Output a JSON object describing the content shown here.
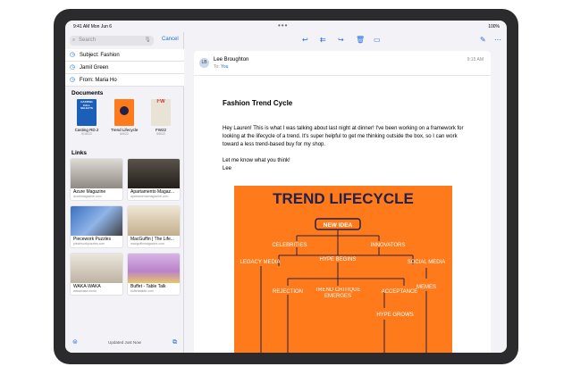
{
  "status": {
    "time": "9:41 AM  Mon Jun 6",
    "dots": "•••",
    "battery": "100%"
  },
  "sidebar": {
    "search_placeholder": "Search",
    "cancel_label": "Cancel",
    "suggestions": [
      "Subject: Fashion",
      "Jamil Green",
      "From: Maria Ho"
    ],
    "documents_heading": "Documents",
    "documents": [
      {
        "name": "Casting RD.2",
        "date": "5/16/22",
        "cover_text": "CASTING CALL SELECTS",
        "color": "#1b5fb8"
      },
      {
        "name": "Trend Lifecycle",
        "date": "6/6/22",
        "cover_text": "",
        "color": "#ff7a1a"
      },
      {
        "name": "FW22",
        "date": "5/8/22",
        "cover_text": "FW",
        "color": "#d33a2f"
      }
    ],
    "links_heading": "Links",
    "links": [
      {
        "title": "Azure Magazine",
        "url": "azuremagazine.com",
        "color": "#b8b4ae"
      },
      {
        "title": "Apartamento Magaz...",
        "url": "apartamentomagazine.com",
        "color": "#3a3631"
      },
      {
        "title": "Piecework Puzzles",
        "url": "pieceworkpuzzles.com",
        "color": "#5a88c9"
      },
      {
        "title": "MacGuffin | The Life...",
        "url": "macguffinmagazine.com",
        "color": "#d7c7a8"
      },
      {
        "title": "WAKA-WAKA",
        "url": "wakawaka.world",
        "color": "#d9d3c8"
      },
      {
        "title": "Buffet - Table Talk",
        "url": "buffetatable.com",
        "color": "#c6a3d8"
      }
    ],
    "footer_status": "Updated Just Now"
  },
  "message": {
    "sender": "Lee Broughton",
    "to_label": "To:",
    "to_value": "You",
    "time": "9:15 AM",
    "subject": "Fashion Trend Cycle",
    "paragraphs": [
      "Hey Lauren! This is what I was talking about last night at dinner! I've been working on a framework for looking at the lifecycle of a trend. It's super helpful to get me thinking outside the box, so I can work toward a less trend-based buy for my shop.",
      "Let me know what you think!\nLee"
    ]
  },
  "poster": {
    "title": "TREND LIFECYCLE",
    "nodes": {
      "new_idea": "NEW IDEA",
      "celebrities": "CELEBRITIES",
      "innovators": "INNOVATORS",
      "legacy_media": "LEGACY MEDIA",
      "hype_begins": "HYPE BEGINS",
      "social_media": "SOCIAL MEDIA",
      "memes": "MEMES",
      "rejection": "REJECTION",
      "trend_critique": "TREND CRITIQUE EMERGES",
      "acceptance": "ACCEPTANCE",
      "hype_grows": "HYPE GROWS"
    }
  },
  "colors": {
    "accent": "#1e6fd9",
    "poster_bg": "#ff7a1a",
    "poster_ink": "#23214a"
  }
}
